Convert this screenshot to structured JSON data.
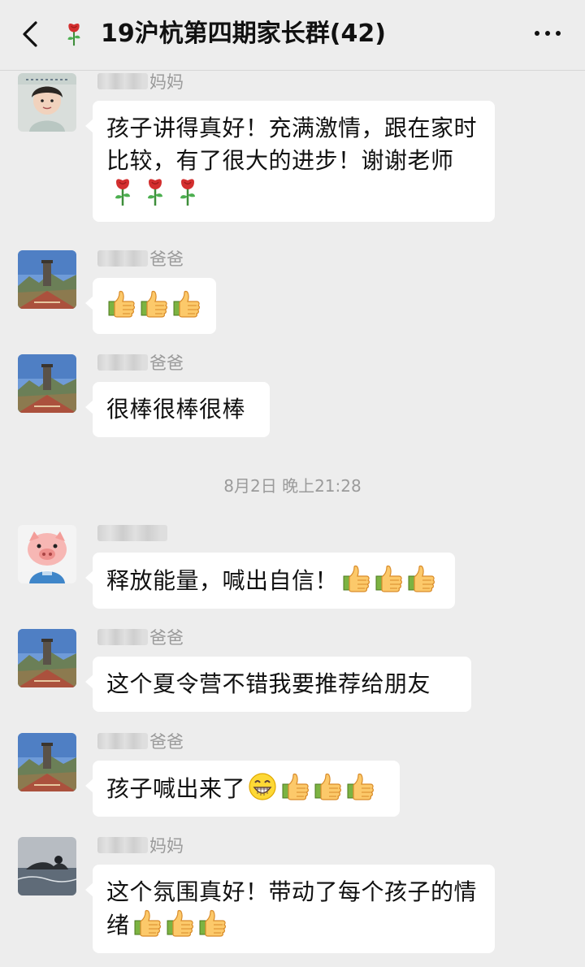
{
  "header": {
    "back_icon": "chevron-left-icon",
    "title_icon": "rose-emoji",
    "title": "19沪杭第四期家长群(42)",
    "more_icon": "ellipsis-icon"
  },
  "timestamp": "8月2日 晚上21:28",
  "messages": [
    {
      "name_suffix": "妈妈",
      "text": "孩子讲得真好！充满激情，跟在家时比较，有了很大的进步！谢谢老师",
      "emojis": [
        "rose",
        "rose",
        "rose"
      ]
    },
    {
      "name_suffix": "爸爸",
      "text": "",
      "emojis": [
        "thumbs-up",
        "thumbs-up",
        "thumbs-up"
      ]
    },
    {
      "name_suffix": "爸爸",
      "text": "很棒很棒很棒",
      "emojis": []
    },
    {
      "name_suffix": "",
      "text": "释放能量，喊出自信！",
      "emojis": [
        "thumbs-up",
        "thumbs-up",
        "thumbs-up"
      ]
    },
    {
      "name_suffix": "爸爸",
      "text": "这个夏令营不错我要推荐给朋友",
      "emojis": []
    },
    {
      "name_suffix": "爸爸",
      "text": "孩子喊出来了",
      "emojis": [
        "grin",
        "thumbs-up",
        "thumbs-up",
        "thumbs-up"
      ]
    },
    {
      "name_suffix": "妈妈",
      "text": "这个氛围真好！带动了每个孩子的情绪",
      "emojis": [
        "thumbs-up",
        "thumbs-up",
        "thumbs-up"
      ]
    }
  ],
  "colors": {
    "background": "#ededed",
    "bubble": "#ffffff",
    "name": "#9b9b9b"
  }
}
